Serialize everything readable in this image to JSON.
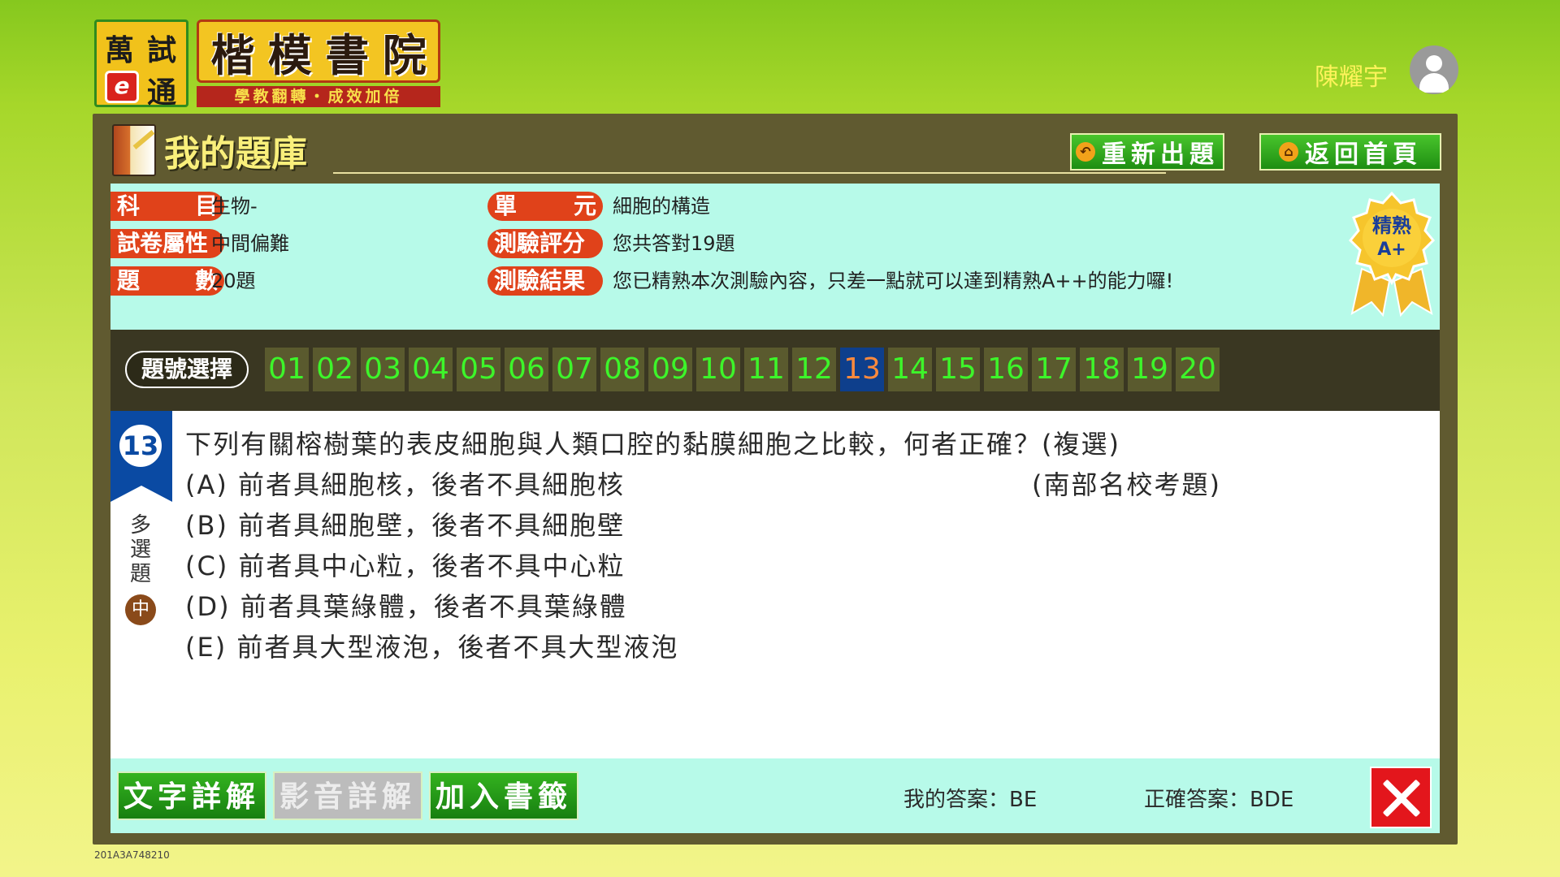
{
  "header": {
    "logo_box": [
      "萬",
      "試",
      "通"
    ],
    "logo_e": "e",
    "logo_title": [
      "楷",
      "模",
      "書",
      "院"
    ],
    "logo_slogan": "學教翻轉・成效加倍",
    "user_name": "陳耀宇"
  },
  "panel": {
    "title": "我的題庫",
    "btn_regenerate": "重新出題",
    "btn_home": "返回首頁"
  },
  "info": {
    "subject_label": [
      "科",
      "目"
    ],
    "subject_value": "生物-",
    "unit_label": [
      "單",
      "元"
    ],
    "unit_value": "細胞的構造",
    "paper_label": "試卷屬性",
    "paper_value": "中間偏難",
    "score_label": "測驗評分",
    "score_value": "您共答對19題",
    "count_label": [
      "題",
      "數"
    ],
    "count_value": "20題",
    "result_label": "測驗結果",
    "result_value": "您已精熟本次測驗內容，只差一點就可以達到精熟A++的能力囉!",
    "medal_line1": "精熟",
    "medal_line2": "A+"
  },
  "question_bar": {
    "label": "題號選擇",
    "numbers": [
      "01",
      "02",
      "03",
      "04",
      "05",
      "06",
      "07",
      "08",
      "09",
      "10",
      "11",
      "12",
      "13",
      "14",
      "15",
      "16",
      "17",
      "18",
      "19",
      "20"
    ],
    "active": "13"
  },
  "question": {
    "number": "13",
    "type": [
      "多",
      "選",
      "題"
    ],
    "level": "中",
    "stem": "下列有關榕樹葉的表皮細胞與人類口腔的黏膜細胞之比較，何者正確？(複選)",
    "source": "(南部名校考題)",
    "options": [
      "(A) 前者具細胞核，後者不具細胞核",
      "(B) 前者具細胞壁，後者不具細胞壁",
      "(C) 前者具中心粒，後者不具中心粒",
      "(D) 前者具葉綠體，後者不具葉綠體",
      "(E) 前者具大型液泡，後者不具大型液泡"
    ]
  },
  "actions": {
    "text_explain": "文字詳解",
    "video_explain": "影音詳解",
    "bookmark": "加入書籤",
    "my_answer_label": "我的答案：",
    "my_answer": "BE",
    "correct_answer_label": "正確答案：",
    "correct_answer": "BDE"
  },
  "footer_code": "201A3A748210",
  "colors": {
    "panel_bg": "#605a30",
    "info_bg": "#b7fae9",
    "tag_red": "#e0421a",
    "qnum_green": "#3df52a",
    "active_blue": "#0e3f8c",
    "wrong_red": "#e3161c"
  }
}
